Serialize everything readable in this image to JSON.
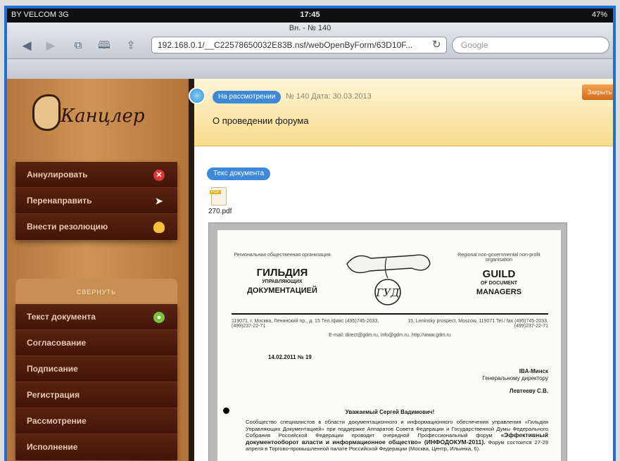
{
  "statusbar": {
    "carrier": "BY VELCOM 3G",
    "time": "17:45",
    "battery": "47%"
  },
  "browser": {
    "tab_title": "Вн. - № 140",
    "url": "192.168.0.1/__C22578650032E83B.nsf/webOpenByForm/63D10F...",
    "search_placeholder": "Google",
    "back_icon": "back-arrow-icon",
    "forward_icon": "forward-arrow-icon",
    "tabs_icon": "tabs-icon",
    "bookmarks_icon": "bookmarks-icon",
    "share_icon": "share-icon"
  },
  "logo": {
    "text": "Канцлер"
  },
  "actions_menu": [
    {
      "label": "Аннулировать",
      "icon": "cancel-icon",
      "color": "#e03434"
    },
    {
      "label": "Перенаправить",
      "icon": "paper-plane-icon",
      "color": "#f0f0f0"
    },
    {
      "label": "Внести резолюцию",
      "icon": "lightbulb-icon",
      "color": "#f5c13b"
    }
  ],
  "collapse_label": "СВЕРНУТЬ",
  "sections_menu": [
    {
      "label": "Текст документа",
      "active": true
    },
    {
      "label": "Согласование"
    },
    {
      "label": "Подписание"
    },
    {
      "label": "Регистрация"
    },
    {
      "label": "Рассмотрение"
    },
    {
      "label": "Исполнение"
    }
  ],
  "header": {
    "status": "На рассмотрении",
    "meta": "№ 140 Дата: 30.03.2013",
    "title": "О проведении форума",
    "close_label": "Закрыть"
  },
  "content": {
    "text_tab": "Текс документа",
    "attachment": "270.pdf",
    "letter": {
      "org_left_small": "Региональная общественная организация",
      "org_left_big": "ГИЛЬДИЯ",
      "org_left_small2": "УПРАВЛЯЮЩИХ",
      "org_left_big2": "ДОКУМЕНТАЦИЕЙ",
      "org_right_small": "Regional non-governmental non-profit organisation",
      "org_right_big": "GUILD",
      "org_right_small2": "OF DOCUMENT",
      "org_right_big2": "MANAGERS",
      "seal": "ГУД",
      "address_left": "119071, г. Москва, Ленинский пр., д. 15 Тел./факс (495)745-2033, (499)237-22-71",
      "address_right": "15, Leninsky prospect, Moscow, 119071 Tel./ fax (495)745-2033, (499)237-22-71",
      "email": "E-mail: direct@gdm.ru, info@gdm.ru, http://www.gdm.ru",
      "doc_number": "14.02.2011 № 19",
      "to_org": "IBA-Минск",
      "to_position": "Генеральному директору",
      "to_name": "Левтееву С.В.",
      "greeting": "Уважаемый Сергей Вадимович!",
      "body": "Сообщество специалистов в области документационного и информационного обеспечения управления «Гильдия Управляющих Документацией» при поддержке Аппаратов Совета Федерации и Государственной Думы Федерального Собрания Российской Федерации проводит очередной Профессиональный форум",
      "body_bold": "«Эффективный документооборот власти и информационное общество» (ИНФОДОКУМ-2011).",
      "body_tail": "Форум состоится 27-29 апреля в Торгово-промышленной палате Российской Федерации (Москва, Центр, Ильинка, 6)."
    }
  }
}
